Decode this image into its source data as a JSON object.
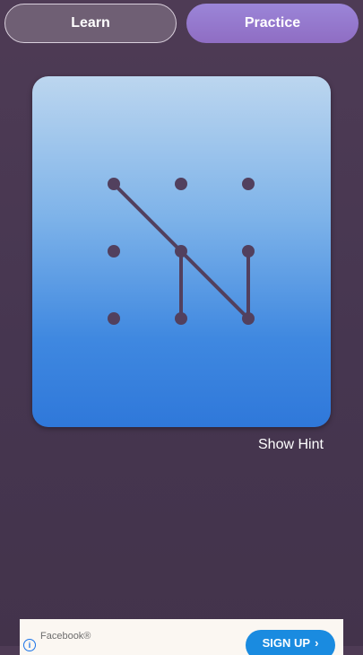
{
  "tabs": {
    "learn": "Learn",
    "practice": "Practice"
  },
  "pattern": {
    "grid": "3x3",
    "path": [
      [
        0,
        0
      ],
      [
        1,
        1
      ],
      [
        2,
        2
      ],
      [
        2,
        1
      ]
    ],
    "extra_segment": [
      [
        1,
        1
      ],
      [
        1,
        2
      ]
    ],
    "dot_color": "#52405e",
    "line_color": "#52405e"
  },
  "hint": {
    "label": "Show Hint"
  },
  "ad": {
    "brand": "Facebook®",
    "cta": "SIGN UP",
    "cta_icon": "chevron-right-icon",
    "info_icon": "info-icon",
    "cta_color": "#1a8be0"
  },
  "colors": {
    "practice_tab": "#9b85d8",
    "card_top": "#bcd6ef",
    "card_bottom": "#2f78da"
  }
}
